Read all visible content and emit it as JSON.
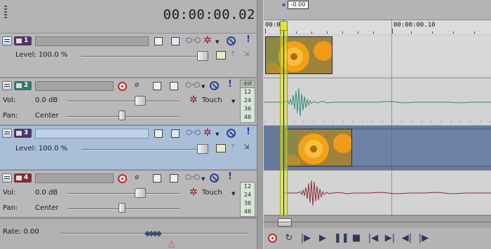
{
  "header": {
    "timecode": "00:00:00.02"
  },
  "ruler": {
    "labels": [
      "00:00",
      "00:00:00.10"
    ],
    "playback_rate_value": "-0.00"
  },
  "tracks": [
    {
      "number": "1",
      "type": "video",
      "level_label": "Level: 100.0 %"
    },
    {
      "number": "2",
      "type": "audio",
      "vol_label": "Vol:",
      "vol_value": "0.0 dB",
      "pan_label": "Pan:",
      "pan_value": "Center",
      "automation": "Touch",
      "meter": {
        "header": "-Inf.",
        "marks": [
          "12",
          "24",
          "36",
          "48"
        ]
      }
    },
    {
      "number": "3",
      "type": "video",
      "level_label": "Level: 100.0 %",
      "selected": true
    },
    {
      "number": "4",
      "type": "audio",
      "vol_label": "Vol:",
      "vol_value": "0.0 dB",
      "pan_label": "Pan:",
      "pan_value": "Center",
      "automation": "Touch",
      "meter": {
        "header": "-Inf.",
        "marks": [
          "12",
          "24",
          "36",
          "48"
        ]
      }
    }
  ],
  "footer": {
    "rate_label": "Rate: 0.00"
  },
  "colors": {
    "selected_track": "#a9bfd8",
    "audio_wave_a": "#2e8b7e",
    "audio_wave_b": "#8a2a3a",
    "loop_region": "#d8e23a"
  }
}
